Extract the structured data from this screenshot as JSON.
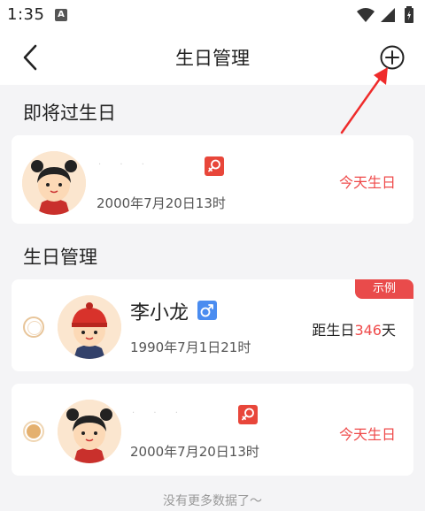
{
  "status_bar": {
    "time": "1:35",
    "notification_icon": "A"
  },
  "header": {
    "title": "生日管理",
    "back_icon": "chevron-left-icon",
    "add_icon": "plus-circle-icon"
  },
  "upcoming": {
    "section_title": "即将过生日",
    "items": [
      {
        "name": "",
        "gender": "female",
        "birth": "2000年7月20日13时",
        "status": "今天生日"
      }
    ]
  },
  "manage": {
    "section_title": "生日管理",
    "items": [
      {
        "name": "李小龙",
        "gender": "male",
        "birth": "1990年7月1日21时",
        "badge": "示例",
        "countdown_prefix": "距生日",
        "countdown_days": "346",
        "countdown_suffix": "天"
      },
      {
        "name": "",
        "gender": "female",
        "birth": "2000年7月20日13时",
        "status": "今天生日"
      }
    ]
  },
  "footer": "没有更多数据了～",
  "colors": {
    "accent_red": "#ef4a4a",
    "female_badge": "#e8463a",
    "male_badge": "#4a8cf0",
    "avatar_bg": "#fbe6cf",
    "page_bg": "#f4f4f6"
  }
}
